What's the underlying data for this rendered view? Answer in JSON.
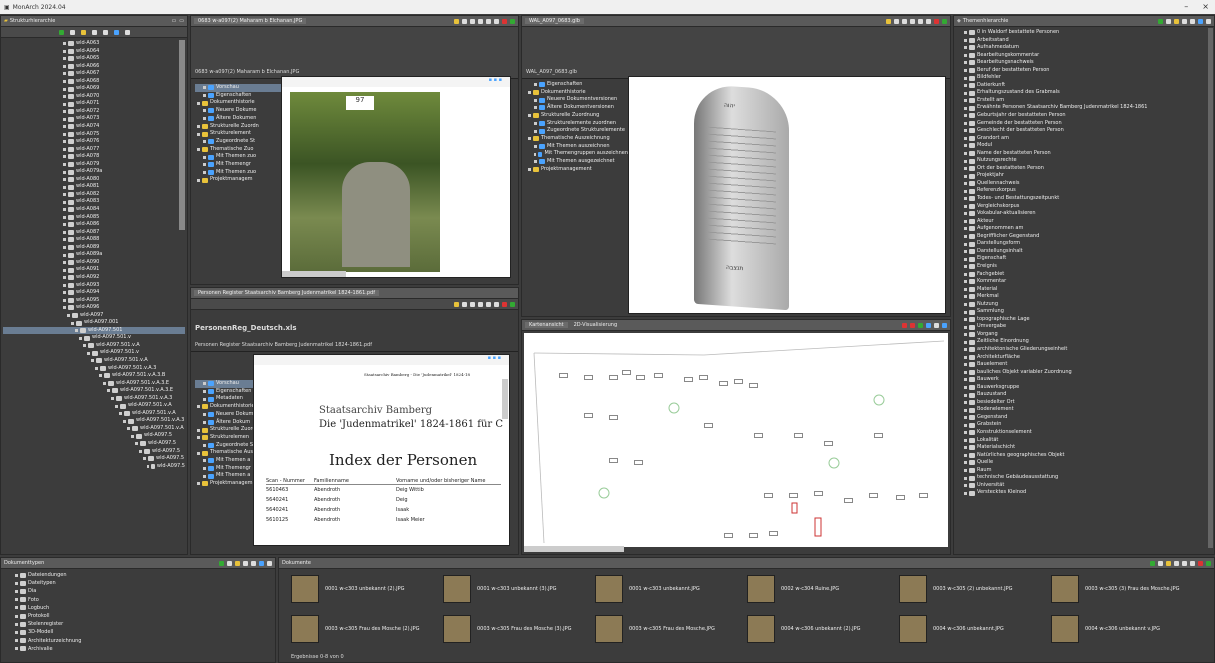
{
  "app": {
    "title": "MonArch 2024.04",
    "min": "–",
    "close": "×"
  },
  "tree_panel": {
    "title": "Strukturhierarchie",
    "items": [
      "wld-A063",
      "wld-A064",
      "wld-A065",
      "wld-A066",
      "wld-A067",
      "wld-A068",
      "wld-A069",
      "wld-A070",
      "wld-A071",
      "wld-A072",
      "wld-A073",
      "wld-A074",
      "wld-A075",
      "wld-A076",
      "wld-A077",
      "wld-A078",
      "wld-A079",
      "wld-A079a",
      "wld-A080",
      "wld-A081",
      "wld-A082",
      "wld-A083",
      "wld-A084",
      "wld-A085",
      "wld-A086",
      "wld-A087",
      "wld-A088",
      "wld-A089",
      "wld-A089a",
      "wld-A090",
      "wld-A091",
      "wld-A092",
      "wld-A093",
      "wld-A094",
      "wld-A095",
      "wld-A096",
      "wld-A097",
      "wld-A097.001",
      "wld-A097.501",
      "wld-A097.501.v",
      "wld-A097.501.v.A",
      "wld-A097.501.v",
      "wld-A097.501.v.A",
      "wld-A097.501.v.A.3",
      "wld-A097.501.v.A.3.B",
      "wld-A097.501.v.A.3.E",
      "wld-A097.501.v.A.3.E",
      "wld-A097.501.v.A.3",
      "wld-A097.501.v.A",
      "wld-A097.501.v.A",
      "wld-A097.501.v.A.3",
      "wld-A097.501.v.A",
      "wld-A097.5",
      "wld-A097.5",
      "wld-A097.5",
      "wld-A097.5",
      "wld-A097.5"
    ]
  },
  "doc1": {
    "tab": "0683 w-a097(2) Maharam b Elchanan.JPG",
    "caption": "0683 w-a097(2) Maharam b Elchanan.JPG",
    "tree": [
      "Vorschau",
      "Eigenschaften",
      "Dokumenthistorie",
      "Neuere Dokume",
      "Ältere Dokumen",
      "Strukturelle Zuordn",
      "Strukturelement",
      "Zugeordnete St",
      "Thematische Zuo",
      "Mit Themen zuo",
      "Mit Themengr",
      "Mit Themen zuo",
      "Projektmanagem"
    ],
    "stone_label": "97"
  },
  "doc2": {
    "tab": "WAL_A097_0683.glb",
    "caption": "WAL_A097_0683.glb",
    "tree": [
      "Eigenschaften",
      "Dokumenthistorie",
      "Neuere Dokumentversionen",
      "Ältere Dokumentversionen",
      "Strukturelle Zuordnung",
      "Strukturelemente zuordnen",
      "Zugeordnete Strukturelemente",
      "Thematische Auszeichnung",
      "Mit Themen auszeichnen",
      "Mit Themengruppen auszeichnen",
      "Mit Themen ausgezeichnet",
      "Projektmanagement"
    ],
    "stone_top": "יהוה",
    "stone_bottom": "תנצבה"
  },
  "doc3": {
    "tab": "Personen Register Staatsarchiv Bamberg Judenmatrikel 1824-1861.pdf",
    "title": "PersonenReg_Deutsch.xls",
    "caption": "Personen Register Staatsarchiv Bamberg Judenmatrikel 1824-1861.pdf",
    "tree": [
      "Vorschau",
      "Eigenschaften",
      "Metadaten",
      "Dokumenthistorie",
      "Neuere Dokum",
      "Ältere Dokum",
      "Strukturelle Zuore",
      "Strukturelemen",
      "Zugeordnete S",
      "Thematische Ausz",
      "Mit Themen a",
      "Mit Themengr",
      "Mit Themen a",
      "Projektmanagem"
    ],
    "pdf_header": "Staatsarchiv Bamberg - Die 'Judenmatrikel' 1824-18",
    "pdf_line1": "Staatsarchiv Bamberg",
    "pdf_line2": "Die 'Judenmatrikel' 1824-1861 für C",
    "pdf_heading": "Index der Personen",
    "columns": [
      "Scan - Nummer",
      "Familienname",
      "Vorname und/oder bisheriger Name"
    ],
    "rows": [
      [
        "5610463",
        "Abendroth",
        "Deig Wittib"
      ],
      [
        "5640241",
        "Abendroth",
        "Deig"
      ],
      [
        "5640241",
        "Abendroth",
        "Isaak"
      ],
      [
        "5610125",
        "Abendroth",
        "Isaak Meier"
      ]
    ]
  },
  "map": {
    "tab1": "Kartenansicht",
    "tab2": "2D-Visualisierung"
  },
  "themes": {
    "title": "Themenhierarchie",
    "items": [
      "0 in Waldorf bestattete Personen",
      "Arbeitsstand",
      "Aufnahmedatum",
      "Bearbeitungskommentar",
      "Bearbeitungsnachweis",
      "Beruf der bestatteten Person",
      "Bildfehler",
      "Datierkunft",
      "Erhaltungszustand des Grabmals",
      "Erstellt am",
      "Erwähnte Personen Staatsarchiv Bamberg Judenmatrikel 1824-1861",
      "Geburtsjahr der bestatteten Person",
      "Gemeinde der bestatteten Person",
      "Geschlecht der bestatteten Person",
      "Grandort am",
      "Modul",
      "Name der bestatteten Person",
      "Nutzungsrechte",
      "Ort der bestatteten Person",
      "Projektjahr",
      "Quellennachweis",
      "Referenzkorpus",
      "Todes- und Bestattungszeitpunkt",
      "Vergleichskorpus",
      "Vokabular-aktualisieren",
      "Akteur",
      "Aufgenommen am",
      "Begrifflicher Gegenstand",
      "Darstellungsform",
      "Darstellungsinhalt",
      "Eigenschaft",
      "Ereignis",
      "Fachgebiet",
      "Kommentar",
      "Material",
      "Merkmal",
      "Nutzung",
      "Sammlung",
      "topographische Lage",
      "Umvergabe",
      "Vorgang",
      "Zeitliche Einordnung",
      "architektonische Gliederungseinheit",
      "Architekturfläche",
      "Bauelement",
      "bauliches Objekt variabler Zuordnung",
      "Bauwerk",
      "Bauwerksgruppe",
      "Bauzustand",
      "besiedelter Ort",
      "Bodenelement",
      "Gegenstand",
      "Grabstein",
      "Konstruktionselement",
      "Lokalität",
      "Materialschicht",
      "Natürliches geographisches Objekt",
      "Quelle",
      "Raum",
      "technische Gebäudeausstattung",
      "Universität",
      "Verstecktes Kleinod"
    ]
  },
  "doctypes": {
    "title": "Dokumenttypen",
    "items": [
      "Dateiendungen",
      "Dateitypen",
      "Dia",
      "Foto",
      "Logbuch",
      "Protokoll",
      "Stelenregister",
      "3D-Modell",
      "Architekturzeichnung",
      "Archivalie"
    ]
  },
  "documents": {
    "title": "Dokumente",
    "items": [
      "0001 w-c303 unbekannt (2).JPG",
      "0001 w-c303 unbekannt (3).JPG",
      "0001 w-c303 unbekannt.JPG",
      "0002 w-c304 Ruine.JPG",
      "0003 w-c305 (2) unbekannt.JPG",
      "0003 w-c305 (3) Frau des Mosche.JPG",
      "0003 w-c305 Frau des Mosche (2).JPG",
      "0003 w-c305 Frau des Mosche (3).JPG",
      "0003 w-c305 Frau des Mosche.JPG",
      "0004 w-c306 unbekannt (2).JPG",
      "0004 w-c306 unbekannt.JPG",
      "0004 w-c306 unbekannt v.JPG"
    ],
    "status": "Ergebnisse 0-8 von 0"
  }
}
